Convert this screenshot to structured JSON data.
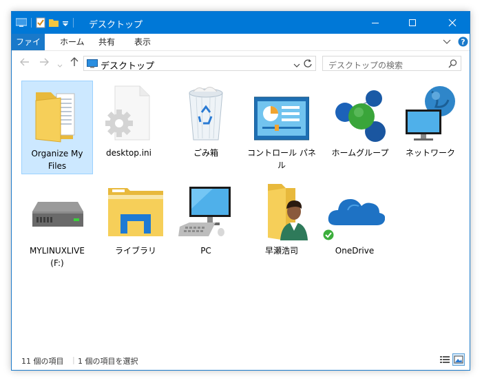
{
  "window": {
    "title": "デスクトップ"
  },
  "ribbon": {
    "tabs": [
      "ファイル",
      "ホーム",
      "共有",
      "表示"
    ]
  },
  "address": {
    "path": "デスクトップ"
  },
  "search": {
    "placeholder": "デスクトップの検索"
  },
  "items": [
    {
      "label": "Organize My Files",
      "icon": "folder-documents-icon",
      "selected": true
    },
    {
      "label": "desktop.ini",
      "icon": "settings-file-icon"
    },
    {
      "label": "ごみ箱",
      "icon": "recycle-bin-icon"
    },
    {
      "label": "コントロール パネル",
      "icon": "control-panel-icon"
    },
    {
      "label": "ホームグループ",
      "icon": "homegroup-icon"
    },
    {
      "label": "ネットワーク",
      "icon": "network-icon"
    },
    {
      "label": "MYLINUXLIVE (F:)",
      "icon": "drive-icon"
    },
    {
      "label": "ライブラリ",
      "icon": "libraries-icon"
    },
    {
      "label": "PC",
      "icon": "pc-icon"
    },
    {
      "label": "早瀬浩司",
      "icon": "user-folder-icon"
    },
    {
      "label": "OneDrive",
      "icon": "onedrive-icon"
    }
  ],
  "status": {
    "count": "11 個の項目",
    "selection": "1 個の項目を選択"
  },
  "colors": {
    "titlebar": "#0078d7",
    "selection": "#cce8ff",
    "accent": "#1979ca"
  }
}
